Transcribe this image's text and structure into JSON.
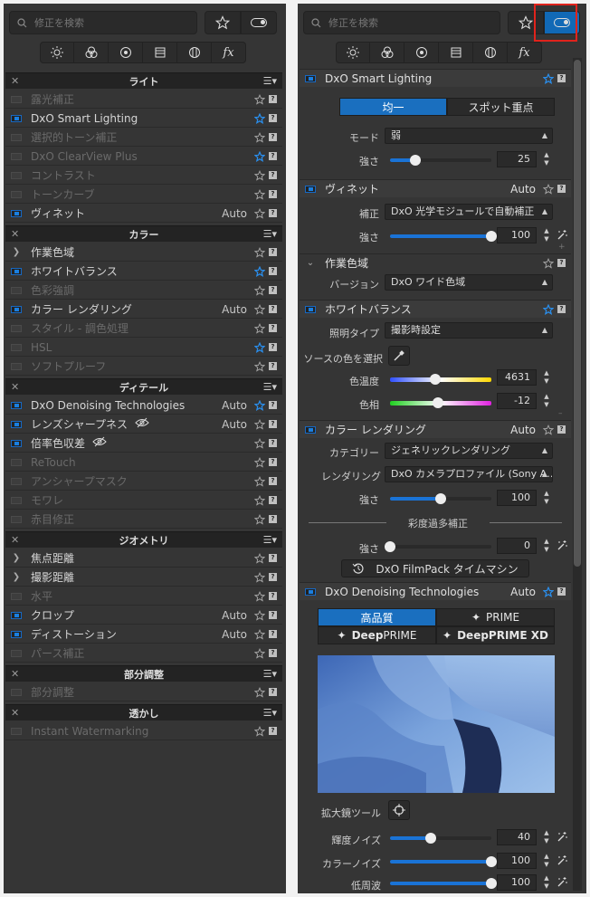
{
  "search": {
    "placeholder": "修正を検索"
  },
  "left": {
    "categories": [
      {
        "title": "ライト",
        "items": [
          {
            "label": "露光補正",
            "enabled": false,
            "fav": false
          },
          {
            "label": "DxO Smart Lighting",
            "enabled": true,
            "fav": true
          },
          {
            "label": "選択的トーン補正",
            "enabled": false,
            "fav": false
          },
          {
            "label": "DxO ClearView Plus",
            "enabled": false,
            "fav": true
          },
          {
            "label": "コントラスト",
            "enabled": false,
            "fav": false
          },
          {
            "label": "トーンカーブ",
            "enabled": false,
            "fav": false
          },
          {
            "label": "ヴィネット",
            "enabled": true,
            "fav": false,
            "auto": "Auto"
          }
        ]
      },
      {
        "title": "カラー",
        "items": [
          {
            "label": "作業色域",
            "enabled": true,
            "fav": false,
            "chevron": true
          },
          {
            "label": "ホワイトバランス",
            "enabled": true,
            "fav": true
          },
          {
            "label": "色彩強調",
            "enabled": false,
            "fav": false
          },
          {
            "label": "カラー レンダリング",
            "enabled": true,
            "fav": false,
            "auto": "Auto"
          },
          {
            "label": "スタイル - 調色処理",
            "enabled": false,
            "fav": false
          },
          {
            "label": "HSL",
            "enabled": false,
            "fav": true
          },
          {
            "label": "ソフトプルーフ",
            "enabled": false,
            "fav": false
          }
        ]
      },
      {
        "title": "ディテール",
        "items": [
          {
            "label": "DxO Denoising Technologies",
            "enabled": true,
            "fav": true,
            "auto": "Auto"
          },
          {
            "label": "レンズシャープネス",
            "enabled": true,
            "fav": false,
            "auto": "Auto",
            "eye": true
          },
          {
            "label": "倍率色収差",
            "enabled": true,
            "fav": false,
            "eye": true
          },
          {
            "label": "ReTouch",
            "enabled": false,
            "fav": false
          },
          {
            "label": "アンシャープマスク",
            "enabled": false,
            "fav": false
          },
          {
            "label": "モワレ",
            "enabled": false,
            "fav": false
          },
          {
            "label": "赤目修正",
            "enabled": false,
            "fav": false
          }
        ]
      },
      {
        "title": "ジオメトリ",
        "items": [
          {
            "label": "焦点距離",
            "enabled": true,
            "fav": false,
            "chevron": true
          },
          {
            "label": "撮影距離",
            "enabled": true,
            "fav": false,
            "chevron": true
          },
          {
            "label": "水平",
            "enabled": false,
            "fav": false
          },
          {
            "label": "クロップ",
            "enabled": true,
            "fav": false,
            "auto": "Auto"
          },
          {
            "label": "ディストーション",
            "enabled": true,
            "fav": false,
            "auto": "Auto"
          },
          {
            "label": "パース補正",
            "enabled": false,
            "fav": false
          }
        ]
      },
      {
        "title": "部分調整",
        "items": [
          {
            "label": "部分調整",
            "enabled": false,
            "fav": false
          }
        ]
      },
      {
        "title": "透かし",
        "items": [
          {
            "label": "Instant Watermarking",
            "enabled": false,
            "fav": false
          }
        ]
      }
    ]
  },
  "right": {
    "smart_lighting": {
      "title": "DxO Smart Lighting",
      "seg1": "均一",
      "seg2": "スポット重点",
      "mode_label": "モード",
      "mode_value": "弱",
      "strength_label": "強さ",
      "strength_value": "25",
      "strength_frac": 0.25
    },
    "vignette": {
      "title": "ヴィネット",
      "auto": "Auto",
      "correction_label": "補正",
      "correction_value": "DxO 光学モジュールで自動補正",
      "strength_label": "強さ",
      "strength_value": "100",
      "strength_frac": 1.0
    },
    "working_space": {
      "title": "作業色域",
      "version_label": "バージョン",
      "version_value": "DxO ワイド色域"
    },
    "white_balance": {
      "title": "ホワイトバランス",
      "light_label": "照明タイプ",
      "light_value": "撮影時設定",
      "source_label": "ソースの色を選択",
      "temp_label": "色温度",
      "temp_value": "4631",
      "temp_frac": 0.45,
      "tint_label": "色相",
      "tint_value": "-12",
      "tint_frac": 0.47
    },
    "color_rendering": {
      "title": "カラー レンダリング",
      "auto": "Auto",
      "category_label": "カテゴリー",
      "category_value": "ジェネリックレンダリング",
      "rendering_label": "レンダリング",
      "rendering_value": "DxO カメラプロファイル (Sony A…",
      "strength_label": "強さ",
      "strength_value": "100",
      "strength_frac": 0.5,
      "oversat_label": "彩度過多補正",
      "oversat_strength_label": "強さ",
      "oversat_value": "0",
      "oversat_frac": 0.0,
      "filmpack_label": "DxO FilmPack タイムマシン"
    },
    "denoising": {
      "title": "DxO Denoising Technologies",
      "auto": "Auto",
      "mode1": "高品質",
      "mode2": "PRIME",
      "mode3_pre": "Deep",
      "mode3_post": "PRIME",
      "mode4_pre": "Deep",
      "mode4_post": "PRIME XD",
      "loupe_label": "拡大鏡ツール",
      "luma_label": "輝度ノイズ",
      "luma_value": "40",
      "luma_frac": 0.4,
      "chroma_label": "カラーノイズ",
      "chroma_value": "100",
      "chroma_frac": 1.0,
      "low_label": "低周波",
      "low_value": "100",
      "low_frac": 1.0
    }
  },
  "colors": {
    "accent": "#1a73d6",
    "active_button": "#1169b6",
    "highlight": "#e0231c",
    "panel": "#353535"
  }
}
